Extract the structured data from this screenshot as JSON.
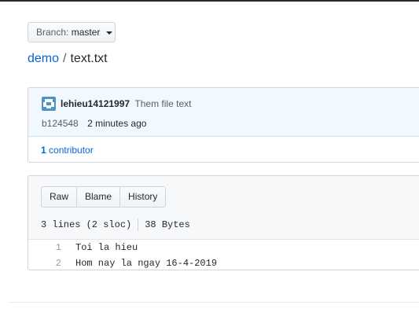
{
  "branch": {
    "prefix": "Branch:",
    "name": "master"
  },
  "breadcrumb": {
    "repo": "demo",
    "separator": "/",
    "file": "text.txt"
  },
  "commit": {
    "author": "lehieu14121997",
    "message": "Them file text",
    "sha": "b124548",
    "time": "2 minutes ago",
    "contributors_count": "1",
    "contributors_label": "contributor"
  },
  "file": {
    "buttons": {
      "raw": "Raw",
      "blame": "Blame",
      "history": "History"
    },
    "lines_info": "3 lines (2 sloc)",
    "size": "38 Bytes",
    "code_lines": [
      {
        "num": "1",
        "text": "Toi la hieu"
      },
      {
        "num": "2",
        "text": "Hom nay la ngay 16-4-2019"
      }
    ]
  },
  "colors": {
    "link": "#0366d6",
    "header_bg": "#f1f8ff",
    "file_header_bg": "#f6f8fa"
  },
  "icons": {
    "avatar": "identicon-avatar",
    "caret": "caret-down-icon"
  }
}
